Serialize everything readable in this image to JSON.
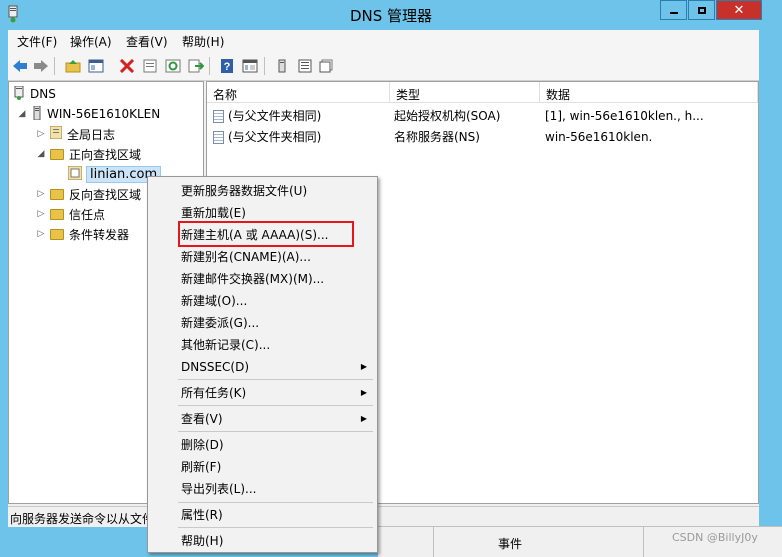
{
  "window": {
    "title": "DNS 管理器"
  },
  "menubar": {
    "items": [
      "文件(F)",
      "操作(A)",
      "查看(V)",
      "帮助(H)"
    ]
  },
  "toolbar": {
    "icons": [
      "back-icon",
      "forward-icon",
      "up-folder-icon",
      "show-hide-tree-icon",
      "delete-icon",
      "properties-icon",
      "refresh-icon",
      "export-icon",
      "help-icon",
      "view-icon",
      "update-server-icon",
      "list-icon",
      "details-icon"
    ]
  },
  "tree": {
    "root": "DNS",
    "server": "WIN-56E1610KLEN",
    "nodes": {
      "global_log": "全局日志",
      "forward_zone": "正向查找区域",
      "zone": "linian.com",
      "reverse_zone": "反向查找区域",
      "trust": "信任点",
      "forwarders": "条件转发器"
    }
  },
  "list": {
    "columns": [
      "名称",
      "类型",
      "数据"
    ],
    "rows": [
      {
        "name": "(与父文件夹相同)",
        "type": "起始授权机构(SOA)",
        "data": "[1], win-56e1610klen., h..."
      },
      {
        "name": "(与父文件夹相同)",
        "type": "名称服务器(NS)",
        "data": "win-56e1610klen."
      }
    ]
  },
  "status": {
    "text": "向服务器发送命令以从文件"
  },
  "context_menu": {
    "items": [
      {
        "label": "更新服务器数据文件(U)"
      },
      {
        "label": "重新加载(E)"
      },
      {
        "label": "新建主机(A 或 AAAA)(S)..."
      },
      {
        "label": "新建别名(CNAME)(A)..."
      },
      {
        "label": "新建邮件交换器(MX)(M)..."
      },
      {
        "label": "新建域(O)..."
      },
      {
        "label": "新建委派(G)..."
      },
      {
        "label": "其他新记录(C)..."
      },
      {
        "label": "DNSSEC(D)"
      },
      {
        "label": "所有任务(K)"
      },
      {
        "label": "查看(V)"
      },
      {
        "label": "删除(D)"
      },
      {
        "label": "刷新(F)"
      },
      {
        "label": "导出列表(L)..."
      },
      {
        "label": "属性(R)"
      },
      {
        "label": "帮助(H)"
      }
    ],
    "highlighted": "新建主机(A 或 AAAA)(S)..."
  },
  "background_window": {
    "label": "事件"
  },
  "watermark": "CSDN @BillyJ0y",
  "colors": {
    "title_bar": "#6ec3ea",
    "close_button": "#c7312a",
    "highlight_box": "#e5171b"
  }
}
